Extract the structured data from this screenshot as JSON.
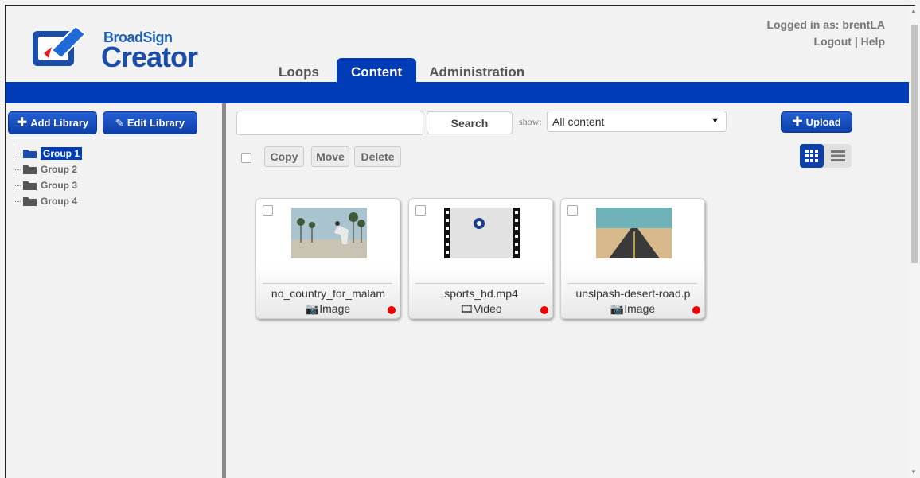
{
  "header": {
    "brand_small": "BroadSign",
    "brand_big": "Creator",
    "user_label": "Logged in as: brentLA",
    "logout_label": "Logout",
    "separator": "|",
    "help_label": "Help"
  },
  "tabs": [
    {
      "label": "Loops",
      "active": false
    },
    {
      "label": "Content",
      "active": true
    },
    {
      "label": "Administration",
      "active": false
    }
  ],
  "sidebar": {
    "add_library_label": "Add Library",
    "edit_library_label": "Edit Library",
    "groups": [
      {
        "label": "Group 1",
        "selected": true
      },
      {
        "label": "Group 2",
        "selected": false
      },
      {
        "label": "Group 3",
        "selected": false
      },
      {
        "label": "Group 4",
        "selected": false
      }
    ]
  },
  "toolbar": {
    "search_placeholder": "",
    "search_label": "Search",
    "show_label": "show:",
    "show_value": "All content",
    "upload_label": "Upload",
    "copy_label": "Copy",
    "move_label": "Move",
    "delete_label": "Delete"
  },
  "content_items": [
    {
      "name": "no_country_for_malam",
      "type": "Image",
      "type_icon": "camera-icon",
      "status_color": "#e00000"
    },
    {
      "name": "sports_hd.mp4",
      "type": "Video",
      "type_icon": "film-icon",
      "status_color": "#e00000"
    },
    {
      "name": "unslpash-desert-road.p",
      "type": "Image",
      "type_icon": "camera-icon",
      "status_color": "#e00000"
    }
  ],
  "colors": {
    "accent": "#003cb8",
    "background": "#f2f2f2",
    "status_dot": "#e00000"
  }
}
